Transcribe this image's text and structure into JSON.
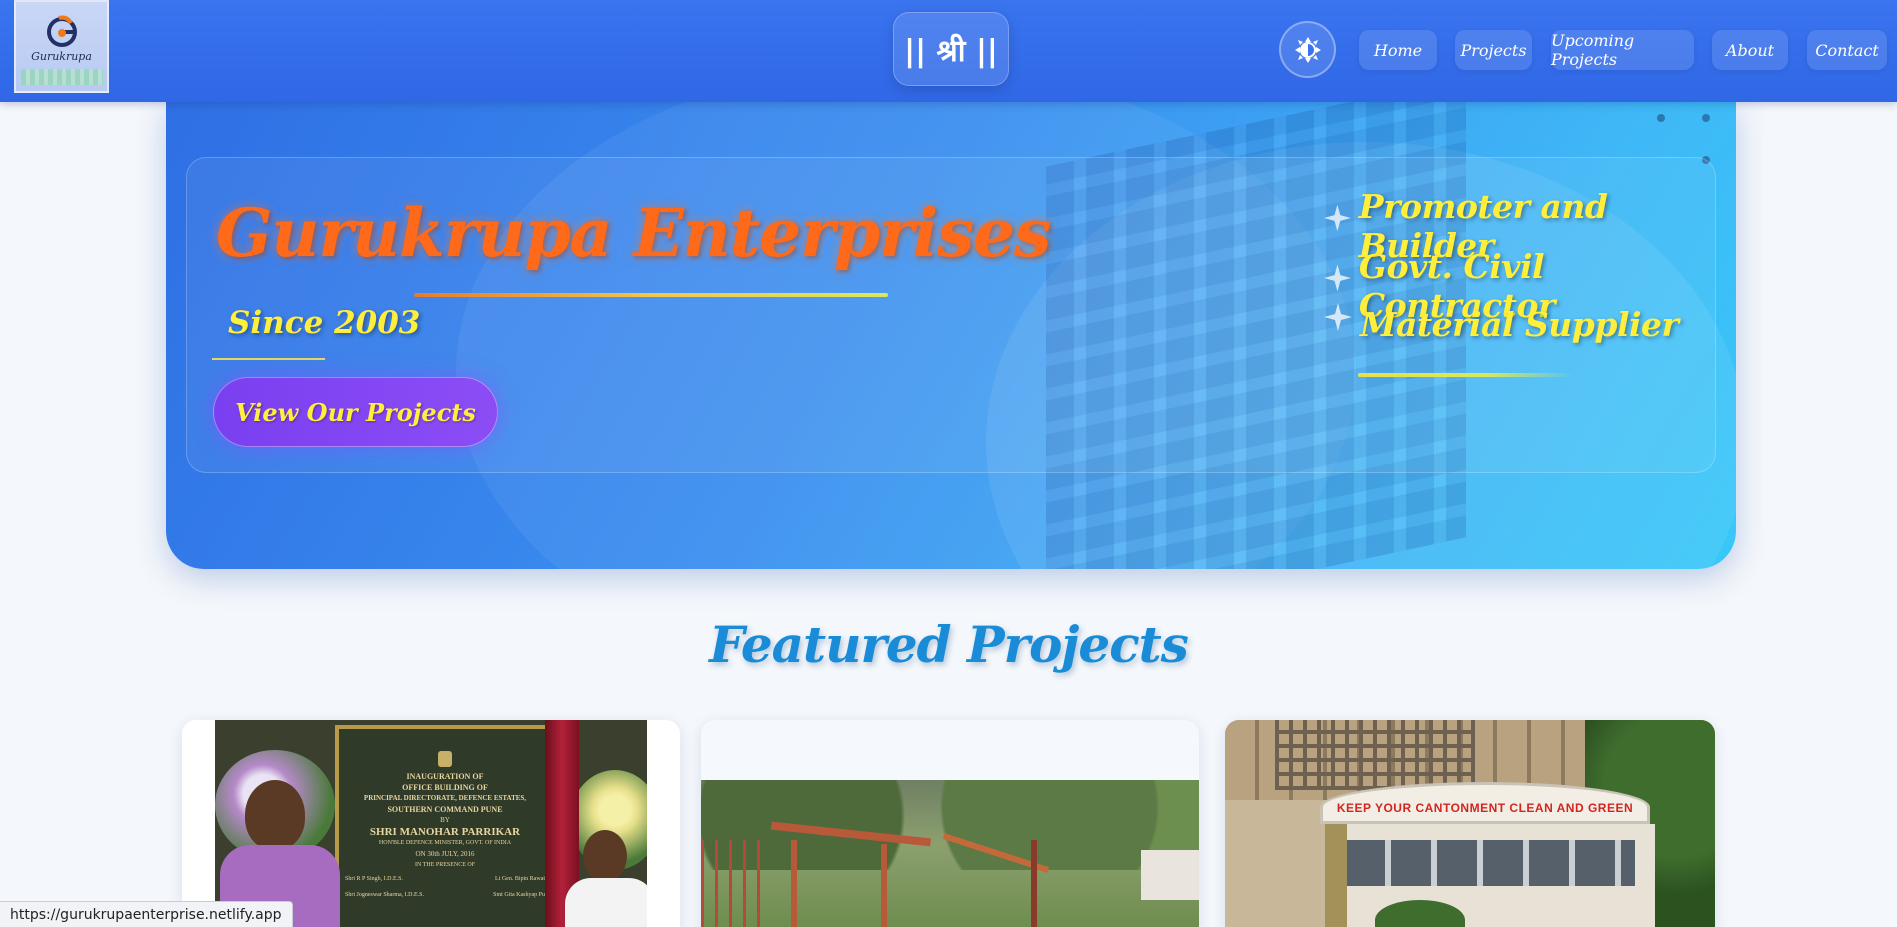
{
  "header": {
    "logo_text": "Gurukrupa",
    "shri_text": "|| श्री ||",
    "nav": [
      {
        "label": "Home"
      },
      {
        "label": "Projects"
      },
      {
        "label": "Upcoming Projects"
      },
      {
        "label": "About"
      },
      {
        "label": "Contact"
      }
    ]
  },
  "hero": {
    "title": "Gurukrupa Enterprises",
    "since": "Since 2003",
    "cta_label": "View Our Projects",
    "services": [
      "Promoter and Builder",
      "Govt. Civil Contractor",
      "Material Supplier"
    ]
  },
  "featured": {
    "heading": "Featured Projects",
    "cards": [
      {
        "plaque_lines": [
          "INAUGURATION OF",
          "OFFICE BUILDING OF",
          "PRINCIPAL DIRECTORATE, DEFENCE ESTATES,",
          "SOUTHERN COMMAND PUNE",
          "BY",
          "SHRI MANOHAR PARRIKAR",
          "HON'BLE DEFENCE MINISTER, GOVT. OF INDIA",
          "ON 30th JULY, 2016",
          "IN THE PRESENCE OF",
          "Shri R P Singh, I.D.E.S.",
          "Lt Gen. Bipin Rawat",
          "Shri Jogneswar Sharma, I.D.E.S.",
          "Smt Gita Kashyap Pu"
        ]
      },
      {},
      {
        "sign_text": "KEEP YOUR CANTONMENT CLEAN AND GREEN"
      }
    ]
  },
  "status_bar": {
    "url": "https://gurukrupaenterprise.netlify.app"
  },
  "colors": {
    "header": "#3a74ef",
    "title_orange": "#ff6a1a",
    "accent_yellow": "#ffee3a",
    "cta_purple": "#7a3ff0",
    "featured_blue": "#1a8bd6"
  },
  "icons": {
    "theme_toggle": "sun-icon",
    "service_bullet": "sparkle-icon"
  }
}
